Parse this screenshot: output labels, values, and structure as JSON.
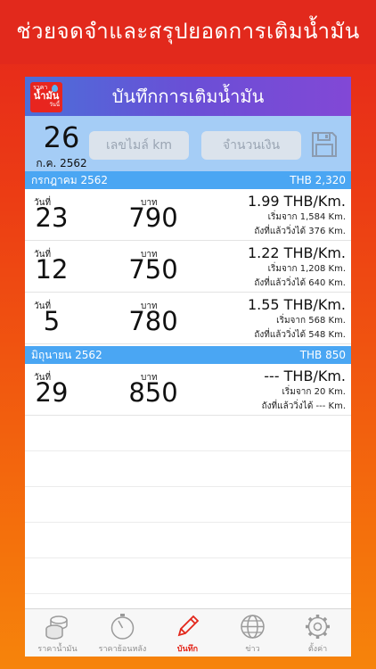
{
  "promo": {
    "headline": "ช่วยจดจำและสรุปยอดการเติมน้ำมัน"
  },
  "app_logo": {
    "line1": "ราคา",
    "line2": "น้ำมัน",
    "line3": "วันนี้"
  },
  "navbar": {
    "title": "บันทึกการเติมน้ำมัน"
  },
  "entry": {
    "day": "26",
    "month": "ก.ค. 2562",
    "mileage_placeholder": "เลขไมล์ km",
    "amount_placeholder": "จำนวนเงิน"
  },
  "labels": {
    "day": "วันที่",
    "baht": "บาท"
  },
  "groups": [
    {
      "month": "กรกฎาคม 2562",
      "total": "THB 2,320",
      "rows": [
        {
          "day": "23",
          "amount": "790",
          "rate": "1.99 THB/Km.",
          "start": "เริ่มจาก 1,584 Km.",
          "distance": "ถังที่แล้ววิ่งได้ 376 Km."
        },
        {
          "day": "12",
          "amount": "750",
          "rate": "1.22 THB/Km.",
          "start": "เริ่มจาก 1,208 Km.",
          "distance": "ถังที่แล้ววิ่งได้ 640 Km."
        },
        {
          "day": "5",
          "amount": "780",
          "rate": "1.55 THB/Km.",
          "start": "เริ่มจาก 568 Km.",
          "distance": "ถังที่แล้ววิ่งได้ 548 Km."
        }
      ]
    },
    {
      "month": "มิถุนายน 2562",
      "total": "THB 850",
      "rows": [
        {
          "day": "29",
          "amount": "850",
          "rate": "--- THB/Km.",
          "start": "เริ่มจาก 20 Km.",
          "distance": "ถังที่แล้ววิ่งได้ --- Km."
        }
      ]
    }
  ],
  "tabs": [
    {
      "label": "ราคาน้ำมัน",
      "icon": "coins-icon"
    },
    {
      "label": "ราคาย้อนหลัง",
      "icon": "stopwatch-icon"
    },
    {
      "label": "บันทึก",
      "icon": "pencil-icon",
      "active": true
    },
    {
      "label": "ข่าว",
      "icon": "globe-icon"
    },
    {
      "label": "ตั้งค่า",
      "icon": "gear-icon"
    }
  ],
  "colors": {
    "accent_red": "#e3271b",
    "navbar_blue": "#4b6fd9",
    "navbar_purple": "#8248d6",
    "month_header_blue": "#4aa6f3",
    "entry_bg": "#a5cdf6"
  }
}
